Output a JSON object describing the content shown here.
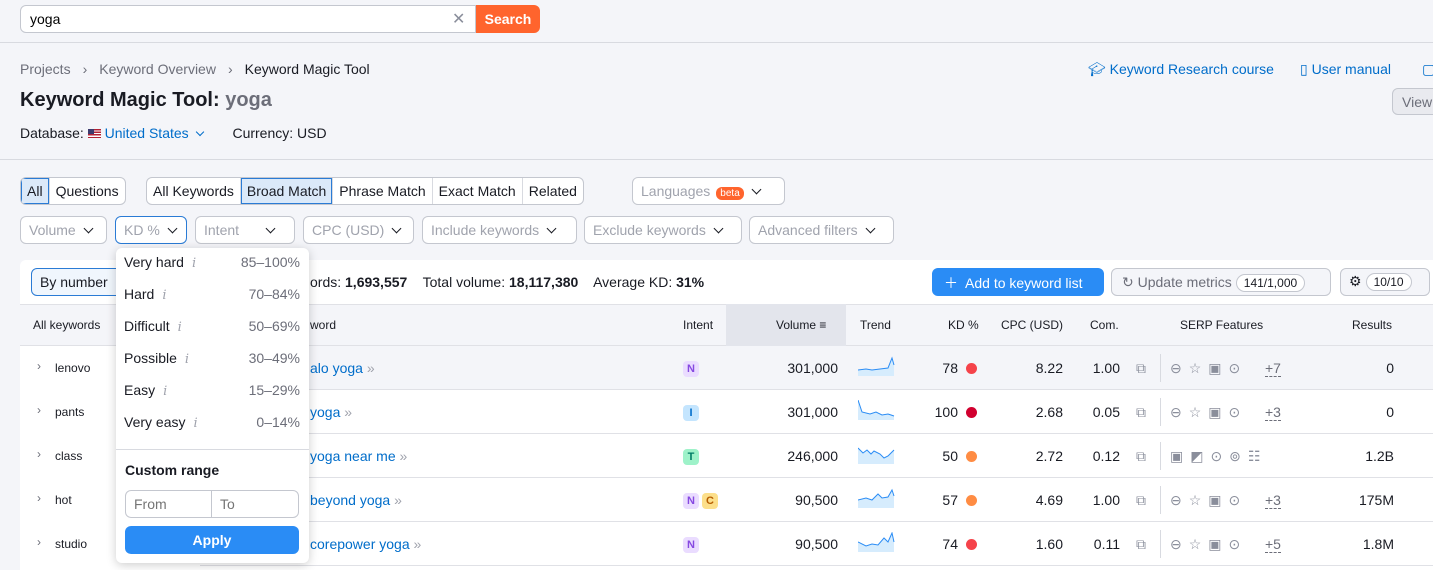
{
  "search": {
    "value": "yoga",
    "button": "Search"
  },
  "breadcrumb": [
    "Projects",
    "Keyword Overview",
    "Keyword Magic Tool"
  ],
  "title": {
    "tool": "Keyword Magic Tool:",
    "query": "yoga"
  },
  "database": {
    "label": "Database:",
    "value": "United States",
    "currency": "Currency: USD"
  },
  "top_links": {
    "course": "Keyword Research course",
    "manual": "User manual",
    "view": "View"
  },
  "tabs1": [
    "All",
    "Questions"
  ],
  "tabs2": [
    "All Keywords",
    "Broad Match",
    "Phrase Match",
    "Exact Match",
    "Related"
  ],
  "languages": {
    "label": "Languages",
    "badge": "beta"
  },
  "filters": [
    "Volume",
    "KD %",
    "Intent",
    "CPC (USD)",
    "Include keywords",
    "Exclude keywords",
    "Advanced filters"
  ],
  "toolbar": {
    "by_number": "By number",
    "keywords_label": "ords:",
    "keywords": "1,693,557",
    "volume_label": "Total volume:",
    "volume": "18,117,380",
    "kd_label": "Average KD:",
    "kd": "31%",
    "add": "Add to keyword list",
    "update": "Update metrics",
    "update_count": "141/1,000",
    "settings_count": "10/10"
  },
  "columns": {
    "all_keywords": "All keywords",
    "keyword": "word",
    "intent": "Intent",
    "volume": "Volume",
    "trend": "Trend",
    "kd": "KD %",
    "cpc": "CPC (USD)",
    "com": "Com.",
    "serp": "SERP Features",
    "results": "Results"
  },
  "sidebar": [
    "lenovo",
    "pants",
    "class",
    "hot",
    "studio"
  ],
  "rows": [
    {
      "keyword": "alo yoga",
      "intent": [
        "N"
      ],
      "volume": "301,000",
      "kd": "78",
      "kd_color": "#f5434a",
      "cpc": "8.22",
      "com": "1.00",
      "serp_more": "+7",
      "results": "0"
    },
    {
      "keyword": "yoga",
      "intent": [
        "I"
      ],
      "volume": "301,000",
      "kd": "100",
      "kd_color": "#d1002f",
      "cpc": "2.68",
      "com": "0.05",
      "serp_more": "+3",
      "results": "0"
    },
    {
      "keyword": "yoga near me",
      "intent": [
        "T"
      ],
      "volume": "246,000",
      "kd": "50",
      "kd_color": "#ff8c43",
      "cpc": "2.72",
      "com": "0.12",
      "serp_more": "",
      "results": "1.2B"
    },
    {
      "keyword": "beyond yoga",
      "intent": [
        "N",
        "C"
      ],
      "volume": "90,500",
      "kd": "57",
      "kd_color": "#ff8c43",
      "cpc": "4.69",
      "com": "1.00",
      "serp_more": "+3",
      "results": "175M"
    },
    {
      "keyword": "corepower yoga",
      "intent": [
        "N"
      ],
      "volume": "90,500",
      "kd": "74",
      "kd_color": "#f5434a",
      "cpc": "1.60",
      "com": "0.11",
      "serp_more": "+5",
      "results": "1.8M"
    }
  ],
  "kd_dropdown": {
    "options": [
      {
        "label": "Very hard",
        "range": "85–100%"
      },
      {
        "label": "Hard",
        "range": "70–84%"
      },
      {
        "label": "Difficult",
        "range": "50–69%"
      },
      {
        "label": "Possible",
        "range": "30–49%"
      },
      {
        "label": "Easy",
        "range": "15–29%"
      },
      {
        "label": "Very easy",
        "range": "0–14%"
      }
    ],
    "custom": "Custom range",
    "from": "From",
    "to": "To",
    "apply": "Apply"
  }
}
